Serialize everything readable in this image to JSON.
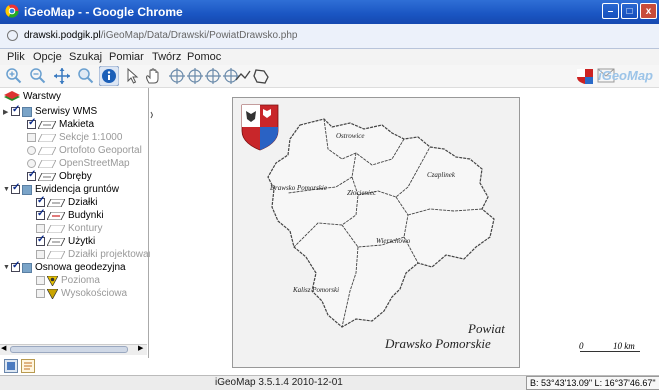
{
  "window": {
    "title": "iGeoMap - - Google Chrome",
    "minimize": "–",
    "maximize": "□",
    "close": "x"
  },
  "address": {
    "domain": "drawski.podgik.pl",
    "path": "/iGeoMap/Data/Drawski/PowiatDrawsko.php"
  },
  "menu": [
    "Plik",
    "Opcje",
    "Szukaj",
    "Pomiar",
    "Twórz",
    "Pomoc"
  ],
  "brand": "iGeoMap",
  "layers": {
    "root": "Warstwy",
    "items": [
      {
        "label": "Serwisy WMS",
        "kind": "group"
      },
      {
        "label": "Makieta",
        "kind": "layer"
      },
      {
        "label": "Sekcje 1:1000",
        "kind": "layer-off"
      },
      {
        "label": "Ortofoto Geoportal",
        "kind": "radio"
      },
      {
        "label": "OpenStreetMap",
        "kind": "radio"
      },
      {
        "label": "Obręby",
        "kind": "layer"
      },
      {
        "label": "Ewidencja gruntów",
        "kind": "group"
      },
      {
        "label": "Działki",
        "kind": "layer"
      },
      {
        "label": "Budynki",
        "kind": "layer"
      },
      {
        "label": "Kontury",
        "kind": "layer-off"
      },
      {
        "label": "Użytki",
        "kind": "layer"
      },
      {
        "label": "Działki projektowane",
        "kind": "layer-off"
      },
      {
        "label": "Osnowa geodezyjna",
        "kind": "group"
      },
      {
        "label": "Pozioma",
        "kind": "point-off"
      },
      {
        "label": "Wysokościowa",
        "kind": "point-off"
      }
    ]
  },
  "map": {
    "regions": [
      "Ostrowice",
      "Drawsko Pomorskie",
      "Złocieniec",
      "Czaplinek",
      "Wierzchowo",
      "Kalisz Pomorski"
    ],
    "caption_line1": "Powiat",
    "caption_line2": "Drawsko Pomorskie",
    "scale_start": "0",
    "scale_end": "10 km"
  },
  "status": {
    "version": "iGeoMap 3.5.1.4 2010-12-01",
    "coords": "B: 53°43'13.09\" L: 16°37'46.67\""
  },
  "colors": {
    "titlebar": "#1a55c2",
    "brand": "#9cc4e8",
    "map_bg": "#f2f2f2"
  }
}
